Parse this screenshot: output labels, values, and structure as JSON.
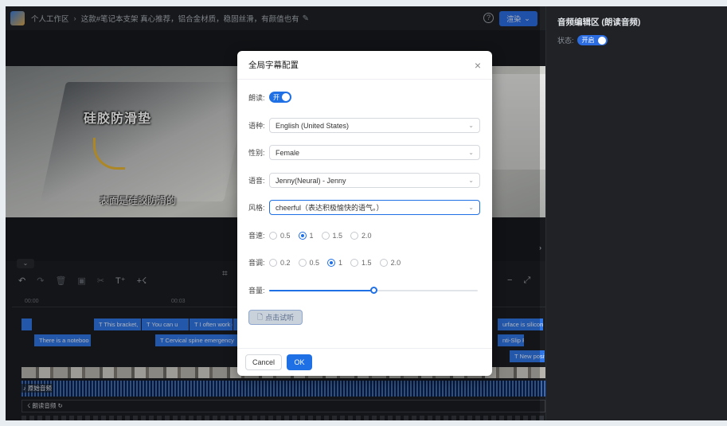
{
  "topbar": {
    "workspace": "个人工作区",
    "title": "这款#笔记本支架 真心推荐，铝合金材质，稳固丝滑，有颜值也有",
    "render_label": "渲染"
  },
  "right_panel": {
    "title": "音频编辑区 (朗读音频)",
    "status_label": "状态:",
    "status_value": "开启"
  },
  "video": {
    "caption_big": "硅胶防滑垫",
    "caption_sub": "表面是硅胶防滑的"
  },
  "timeline": {
    "ruler": [
      "00:00",
      "00:03"
    ],
    "row1": [
      "T This bracket,",
      "T You can u",
      "T I often work e",
      "T"
    ],
    "row1_right": "urface is silicon",
    "row2": [
      "There is a noteboo",
      "T Cervical spine emergency"
    ],
    "row2_right": "nti-Slip P",
    "row3_right": "T New posit",
    "audio_label": "原始音频",
    "tts_label": "朗读音频"
  },
  "modal": {
    "title": "全局字幕配置",
    "read_label": "朗读:",
    "read_switch": "开",
    "lang_label": "语种:",
    "lang_value": "English (United States)",
    "gender_label": "性别:",
    "gender_value": "Female",
    "voice_label": "语音:",
    "voice_value": "Jenny(Neural) - Jenny",
    "style_label": "风格:",
    "style_value": "cheerful（表达积极愉快的语气。）",
    "speed_label": "音速:",
    "speed_options": [
      "0.5",
      "1",
      "1.5",
      "2.0"
    ],
    "speed_selected": "1",
    "pitch_label": "音调:",
    "pitch_options": [
      "0.2",
      "0.5",
      "1",
      "1.5",
      "2.0"
    ],
    "pitch_selected": "1",
    "volume_label": "音量:",
    "volume_fraction": 0.5,
    "listen_label": "点击试听",
    "cancel_label": "Cancel",
    "ok_label": "OK"
  },
  "colors": {
    "accent": "#1f6fe5",
    "clip": "#2f74e3",
    "panel_bg": "#1b1d21"
  }
}
